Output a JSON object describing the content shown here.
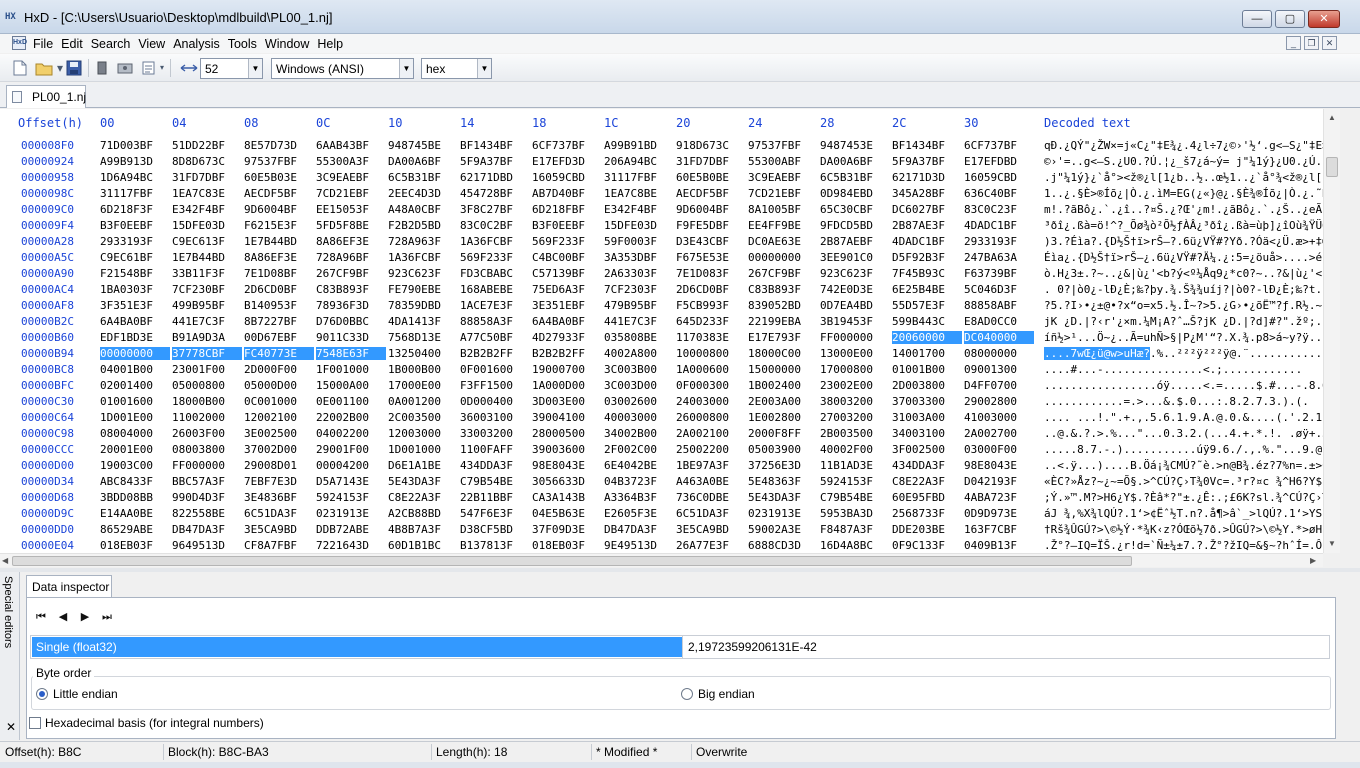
{
  "window": {
    "app_icon": "HX",
    "title": "HxD - [C:\\Users\\Usuario\\Desktop\\mdlbuild\\PL00_1.nj]",
    "controls": {
      "minimize": "—",
      "maximize": "▢",
      "close": "✕"
    }
  },
  "menu": {
    "icon": "HxD",
    "items": [
      "File",
      "Edit",
      "Search",
      "View",
      "Analysis",
      "Tools",
      "Window",
      "Help"
    ],
    "mdi_controls": {
      "minimize": "_",
      "restore": "❐",
      "close": "✕"
    }
  },
  "toolbar": {
    "icons": [
      "new-file-icon",
      "open-folder-icon",
      "save-icon",
      "ram-icon",
      "disk-icon",
      "properties-icon",
      "bytes-per-row-icon"
    ],
    "bytes_per_row": "52",
    "charset": "Windows (ANSI)",
    "offset_base": "hex"
  },
  "tab": {
    "label": "PL00_1.nj"
  },
  "hex": {
    "header": {
      "offset": "Offset(h)",
      "columns": [
        "00",
        "04",
        "08",
        "0C",
        "10",
        "14",
        "18",
        "1C",
        "20",
        "24",
        "28",
        "2C",
        "30"
      ],
      "decoded": "Decoded text"
    },
    "rows": [
      {
        "off": "000008F0",
        "cells": [
          "71D003BF",
          "51DD22BF",
          "8E57D73D",
          "6AAB43BF",
          "948745BE",
          "BF1434BF",
          "6CF737BF",
          "A99B91BD",
          "918D673C",
          "97537FBF",
          "9487453E",
          "BF1434BF",
          "6CF737BF"
        ],
        "text": "qÐ.¿QÝ\"¿ŽW×=j«C¿\"‡E¾¿.4¿l÷7¿©›'½‘.g<—S¿\"‡E>¿.4¿l÷7¿"
      },
      {
        "off": "00000924",
        "cells": [
          "A99B913D",
          "8D8D673C",
          "97537FBF",
          "55300A3F",
          "DA00A6BF",
          "5F9A37BF",
          "E17EFD3D",
          "206A94BC",
          "31FD7DBF",
          "55300ABF",
          "DA00A6BF",
          "5F9A37BF",
          "E17EFDBD"
        ],
        "text": "©›'=..g<—S.¿U0.?Ú.¦¿_š7¿á~ý= j\"¼1ý}¿U0.¿Ú.¦¿_š7¿á~ý½"
      },
      {
        "off": "00000958",
        "cells": [
          "1D6A94BC",
          "31FD7DBF",
          "60E5B03E",
          "3C9EAEBF",
          "6C5B31BF",
          "62171DBD",
          "16059CBD",
          "31117FBF",
          "60E5B0BE",
          "3C9EAEBF",
          "6C5B31BF",
          "62171D3D",
          "16059CBD"
        ],
        "text": ".j\"¼1ý}¿`å°><ž®¿l[1¿b..½..œ½1..¿`å°¾<ž®¿l[1¿b..=..œ½"
      },
      {
        "off": "0000098C",
        "cells": [
          "31117FBF",
          "1EA7C83E",
          "AECDF5BF",
          "7CD21EBF",
          "2EEC4D3D",
          "454728BF",
          "AB7D40BF",
          "1EA7C8BE",
          "AECDF5BF",
          "7CD21EBF",
          "0D984EBD",
          "345A28BF",
          "636C40BF"
        ],
        "text": "1..¿.§È>®Íõ¿|Ò.¿.ìM=EG(¿«}@¿.§È¾®Íõ¿|Ò.¿.˜N½4Z(¿cl@¿"
      },
      {
        "off": "000009C0",
        "cells": [
          "6D218F3F",
          "E342F4BF",
          "9D6004BF",
          "EE15053F",
          "A48A0CBF",
          "3F8C27BF",
          "6D218FBF",
          "E342F4BF",
          "9D6004BF",
          "8A1005BF",
          "65C30CBF",
          "DC6027BF",
          "83C0C23F"
        ],
        "text": "m!.?ãBô¿.`.¿î..?¤Š.¿?Œ'¿m!.¿ãBô¿.`.¿Š..¿eÃ.¿Ü`'¿ƒÀÂ?"
      },
      {
        "off": "000009F4",
        "cells": [
          "B3F0EEBF",
          "15DFE03D",
          "F6215E3F",
          "5FD5F8BE",
          "F2B2D5BD",
          "83C0C2BF",
          "B3F0EEBF",
          "15DFE03D",
          "F9FE5DBF",
          "EE4FF9BE",
          "9FDCD5BD",
          "2B87AE3F",
          "4DADC1BF"
        ],
        "text": "³ðî¿.ßà=ö!^?_Õø¾ò²Õ½ƒÀÂ¿³ðî¿.ßà=ùþ]¿îOù¾ŸÜÕ½+‡®?M­Á¿"
      },
      {
        "off": "00000A28",
        "cells": [
          "2933193F",
          "C9EC613F",
          "1E7B44BD",
          "8A86EF3E",
          "728A963F",
          "1A36FCBF",
          "569F233F",
          "59F0003F",
          "D3E43CBF",
          "DC0AE63E",
          "2B87AEBF",
          "4DADC1BF",
          "2933193F"
        ],
        "text": ")3.?Éìa?.{D½Š†ï>rŠ–?.6ü¿VŸ#?Yð.?Óä<¿Ü.æ>+‡®¿M­Á¿)3.?"
      },
      {
        "off": "00000A5C",
        "cells": [
          "C9EC61BF",
          "1E7B44BD",
          "8A86EF3E",
          "728A96BF",
          "1A36FCBF",
          "569F233F",
          "C4BC00BF",
          "3A353DBF",
          "F675E53E",
          "00000000",
          "3EE901C0",
          "D5F92B3F",
          "247BA63A"
        ],
        "text": "Éìa¿.{D½Š†ï>rŠ–¿.6ü¿VŸ#?Ä¼.¿:5=¿öuå>....>é.ÀÕù+?${¦:"
      },
      {
        "off": "00000A90",
        "cells": [
          "F21548BF",
          "33B11F3F",
          "7E1D08BF",
          "267CF9BF",
          "923C623F",
          "FD3CBABC",
          "C57139BF",
          "2A63303F",
          "7E1D083F",
          "267CF9BF",
          "923C623F",
          "7F45B93C",
          "F63739BF"
        ],
        "text": "ò.H¿3±.?~..¿&|ù¿'<b?ý<º¼Åq9¿*c0?~..?&|ù¿'<b?.E¹<ö79¿"
      },
      {
        "off": "00000AC4",
        "cells": [
          "1BA0303F",
          "7CF230BF",
          "2D6CD0BF",
          "C83B893F",
          "FE790EBE",
          "168ABEBE",
          "75ED6A3F",
          "7CF2303F",
          "2D6CD0BF",
          "C83B893F",
          "742E0D3E",
          "6E25B4BE",
          "5C046D3F"
        ],
        "text": ". 0?|ò0¿-lÐ¿È;‰?þy.¾.Š¾¾uíj?|ò0?-lÐ¿È;‰?t..>n%´¾\\.m?"
      },
      {
        "off": "00000AF8",
        "cells": [
          "3F351E3F",
          "499B95BF",
          "B140953F",
          "78936F3D",
          "78359DBD",
          "1ACE7E3F",
          "3E351EBF",
          "479B95BF",
          "F5CB993F",
          "839052BD",
          "0D7EA4BD",
          "55D57E3F",
          "88858ABF"
        ],
        "text": "?5.?I›•¿±@•?x“o=x5.½.Î~?>5.¿G›•¿õË™?ƒ.R½.~¤½UÕ~?ˆ…Š¿"
      },
      {
        "off": "00000B2C",
        "cells": [
          "6A4BA0BF",
          "441E7C3F",
          "8B7227BF",
          "D76D0BBC",
          "4DA1413F",
          "88858A3F",
          "6A4BA0BF",
          "441E7C3F",
          "645D233F",
          "22199EBA",
          "3B19453F",
          "599B443C",
          "E8AD0CC0"
        ],
        "text": "jK ¿D.|?‹r'¿×m.¼M¡A?ˆ…Š?jK ¿D.|?d]#?\".žº;.E?Y›D<è­.À"
      },
      {
        "off": "00000B60",
        "cells": [
          "EDF1BD3E",
          "B91A9D3A",
          "00D67EBF",
          "9011C33D",
          "7568D13E",
          "A77C50BF",
          "4D27933F",
          "035808BE",
          "1170383E",
          "E17E793F",
          "FF000000",
          "20060000",
          "DC040000"
        ],
        "sel": [
          11,
          12
        ],
        "text": "íñ½>¹...Ö~¿..Ã=uhÑ>§|P¿M'“?.X.¾.p8>á~y?ÿ... ...Ü..."
      },
      {
        "off": "00000B94",
        "cells": [
          "00000000",
          "37778CBF",
          "FC40773E",
          "7548E63F",
          "13250400",
          "B2B2B2FF",
          "B2B2B2FF",
          "4002A800",
          "10000800",
          "18000C00",
          "13000E00",
          "14001700",
          "08000000"
        ],
        "sel": [
          0,
          1,
          2,
          3
        ],
        "text_sel": "....7wŒ¿ü@w>uHæ?",
        "text": ".%..²²²ÿ²²²ÿ@.¨..........."
      },
      {
        "off": "00000BC8",
        "cells": [
          "04001B00",
          "23001F00",
          "2D000F00",
          "1F001000",
          "1B000B00",
          "0F001600",
          "19000700",
          "3C003B00",
          "1A000600",
          "15000000",
          "17000800",
          "01001B00",
          "09001300"
        ],
        "text": "....#...-...............<.;............"
      },
      {
        "off": "00000BFC",
        "cells": [
          "02001400",
          "05000800",
          "05000D00",
          "15000A00",
          "17000E00",
          "F3FF1500",
          "1A000D00",
          "3C003D00",
          "0F000300",
          "1B002400",
          "23002E00",
          "2D003800",
          "D4FF0700"
        ],
        "text": ".................óÿ.....<.=.....$.#...-.8.Ôÿ.."
      },
      {
        "off": "00000C30",
        "cells": [
          "01001600",
          "18000B00",
          "0C001000",
          "0E001100",
          "0A001200",
          "0D000400",
          "3D003E00",
          "03002600",
          "24003000",
          "2E003A00",
          "38003200",
          "37003300",
          "29002800"
        ],
        "text": "............=.>...&.$.0...:.8.2.7.3.).(."
      },
      {
        "off": "00000C64",
        "cells": [
          "1D001E00",
          "11002000",
          "12002100",
          "22002B00",
          "2C003500",
          "36003100",
          "39004100",
          "40003000",
          "26000800",
          "1E002800",
          "27003200",
          "31003A00",
          "41003000"
        ],
        "text": ".... ...!.\".+.,.5.6.1.9.A.@.0.&....(.'.2.1.:.A.0."
      },
      {
        "off": "00000C98",
        "cells": [
          "08004000",
          "26003F00",
          "3E002500",
          "04002200",
          "12003000",
          "33003200",
          "28000500",
          "34002B00",
          "2A002100",
          "2000F8FF",
          "2B003500",
          "34003100",
          "2A002700"
        ],
        "text": "..@.&.?.>.%...\"...0.3.2.(...4.+.*.!. .øÿ+.5.4.1.*.'."
      },
      {
        "off": "00000CCC",
        "cells": [
          "20001E00",
          "08003800",
          "37002D00",
          "29001F00",
          "1D001000",
          "1100FAFF",
          "39003600",
          "2F002C00",
          "25002200",
          "05003900",
          "40002F00",
          "3F002500",
          "03000F00"
        ],
        "text": " .....8.7.-.)...........úÿ9.6./.,.%.\"...9.@./.?.%....."
      },
      {
        "off": "00000D00",
        "cells": [
          "19003C00",
          "FF000000",
          "29008D01",
          "00004200",
          "D6E1A1BE",
          "434DDA3F",
          "98E8043E",
          "6E4042BE",
          "1BE97A3F",
          "37256E3D",
          "11B1AD3E",
          "434DDA3F",
          "98E8043E"
        ],
        "text": "..<.ÿ...)....B.Öá¡¾CMÚ?˜è.>n@B¾.éz?7%n=.±­>CMÚ?˜è.>"
      },
      {
        "off": "00000D34",
        "cells": [
          "ABC8433F",
          "BBC57A3F",
          "7EBF7E3D",
          "D5A7143E",
          "5E43DA3F",
          "C79B54BE",
          "3056633D",
          "04B3723F",
          "A463A0BE",
          "5E48363F",
          "5924153F",
          "C8E22A3F",
          "D042193F"
        ],
        "text": "«ÈC?»Åz?~¿~=Õ§.>^CÚ?Ç›T¾0Vc=.³r?¤c ¾^H6?Y$.?Èâ*?ÐB.?"
      },
      {
        "off": "00000D68",
        "cells": [
          "3BDD08BB",
          "990D4D3F",
          "3E4836BF",
          "5924153F",
          "C8E22A3F",
          "22B11BBF",
          "CA3A143B",
          "A3364B3F",
          "736C0DBE",
          "5E43DA3F",
          "C79B54BE",
          "60E95FBD",
          "4ABA723F"
        ],
        "text": ";Ý.»™.M?>H6¿Y$.?Èâ*?\"±.¿Ê:.;£6K?sl.¾^CÚ?Ç›T¾`é_½Jºr?"
      },
      {
        "off": "00000D9C",
        "cells": [
          "E14AA0BE",
          "822558BE",
          "6C51DA3F",
          "0231913E",
          "A2CB88BD",
          "547F6E3F",
          "04E5B63E",
          "E2605F3E",
          "6C51DA3F",
          "0231913E",
          "5953BA3D",
          "2568733F",
          "0D9D973E"
        ],
        "text": "áJ ¾‚%X¾lQÚ?.1‘>¢Ëˆ½T.n?.å¶>â`_>lQÚ?.1‘>YSº=%hs?..—>"
      },
      {
        "off": "00000DD0",
        "cells": [
          "86529ABE",
          "DB47DA3F",
          "3E5CA9BD",
          "DDB72ABE",
          "4B8B7A3F",
          "D38CF5BD",
          "37F09D3E",
          "DB47DA3F",
          "3E5CA9BD",
          "59002A3E",
          "F8487A3F",
          "DDE203BE",
          "163F7CBF"
        ],
        "text": "†Rš¾ÛGÚ?>\\©½Ý·*¾K‹z?ÓŒõ½7ð.>ÛGÚ?>\\©½Y.*>øHz?Ýâ.¾.?|¿"
      },
      {
        "off": "00000E04",
        "cells": [
          "018EB03F",
          "9649513D",
          "CF8A7FBF",
          "7221643D",
          "60D1B1BC",
          "B137813F",
          "018EB03F",
          "9E49513D",
          "26A77E3F",
          "6888CD3D",
          "16D4A8BC",
          "0F9C133F",
          "0409B13F"
        ],
        "text": ".Ž°?–IQ=ÏŠ.¿r!d=`Ñ±¼±7.?.Ž°?žIQ=&§~?hˆÍ=.Ô¨¼.œ.?..±?"
      }
    ]
  },
  "inspector": {
    "side_label": "Special editors",
    "side_close": "✕",
    "tab_label": "Data inspector",
    "nav": [
      "⏮",
      "◀",
      "▶",
      "⏭"
    ],
    "field_name": "Single (float32)",
    "field_value": "2,19723599206131E-42",
    "byte_order_label": "Byte order",
    "little_endian": "Little endian",
    "big_endian": "Big endian",
    "hex_basis": "Hexadecimal basis (for integral numbers)"
  },
  "status": {
    "offset": "Offset(h): B8C",
    "block": "Block(h): B8C-BA3",
    "length": "Length(h): 18",
    "modified": "* Modified *",
    "mode": "Overwrite"
  }
}
